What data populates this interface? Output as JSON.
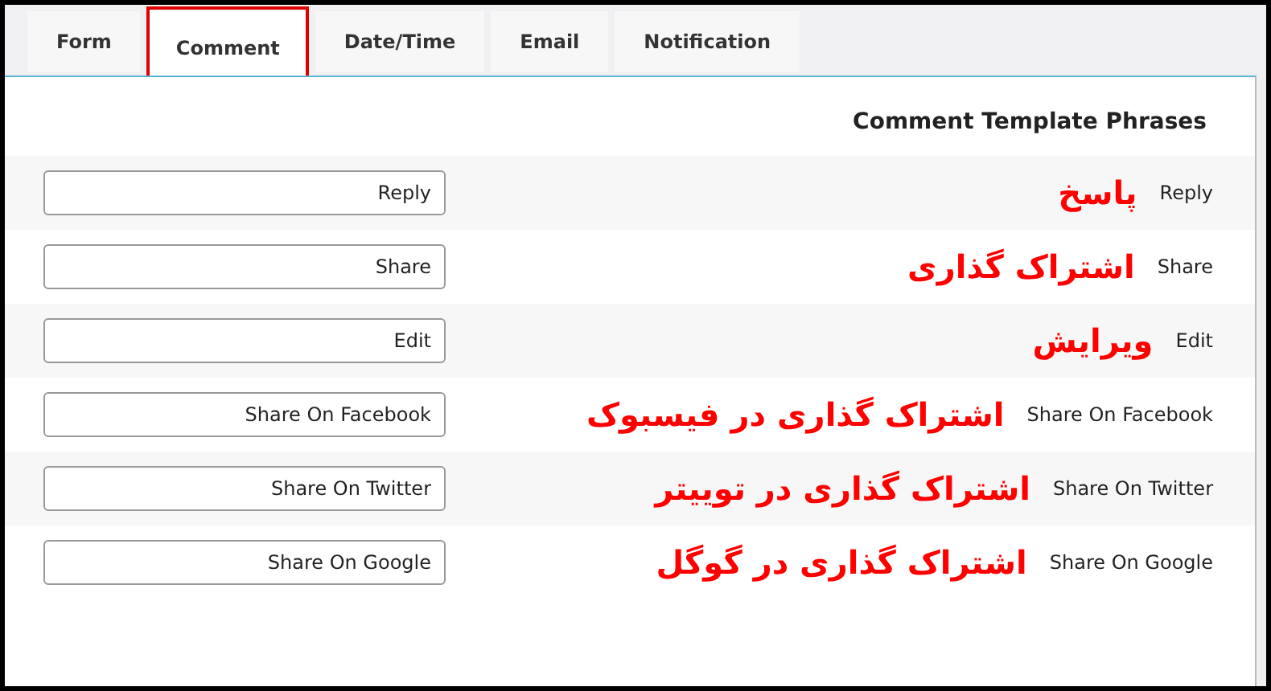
{
  "tabs": [
    {
      "label": "Form",
      "selected": false,
      "highlighted": false
    },
    {
      "label": "Comment",
      "selected": true,
      "highlighted": true
    },
    {
      "label": "Date/Time",
      "selected": false,
      "highlighted": false
    },
    {
      "label": "Email",
      "selected": false,
      "highlighted": false
    },
    {
      "label": "Notification",
      "selected": false,
      "highlighted": false
    }
  ],
  "section_title": "Comment Template Phrases",
  "phrases": [
    {
      "label": "Reply",
      "value": "Reply",
      "annotation": "پاسخ"
    },
    {
      "label": "Share",
      "value": "Share",
      "annotation": "اشتراک گذاری"
    },
    {
      "label": "Edit",
      "value": "Edit",
      "annotation": "ویرایش"
    },
    {
      "label": "Share On Facebook",
      "value": "Share On Facebook",
      "annotation": "اشتراک گذاری در فیسبوک"
    },
    {
      "label": "Share On Twitter",
      "value": "Share On Twitter",
      "annotation": "اشتراک گذاری در توییتر"
    },
    {
      "label": "Share On Google",
      "value": "Share On Google",
      "annotation": "اشتراک گذاری در گوگل"
    }
  ]
}
